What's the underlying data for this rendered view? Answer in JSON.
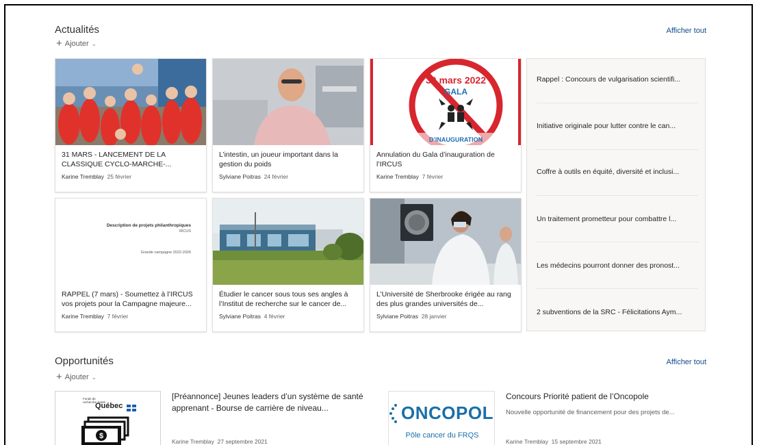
{
  "news": {
    "title": "Actualités",
    "view_all": "Afficher tout",
    "add_label": "Ajouter",
    "cards": [
      {
        "title": "31 MARS - LANCEMENT DE LA CLASSIQUE CYCLO-MARCHE-...",
        "author": "Karine Tremblay",
        "date": "25 février",
        "image": "group-photo-cyclists"
      },
      {
        "title": "L’intestin, un joueur important dans la gestion du poids",
        "author": "Sylviane Poitras",
        "date": "24 février",
        "image": "portrait-lab-photo"
      },
      {
        "title": "Annulation du Gala d’inauguration de l’IRCUS",
        "author": "Karine Tremblay",
        "date": "7 février",
        "image": "cancelled-gala-poster",
        "poster": {
          "date": "30 mars 2022",
          "event": "GALA",
          "caption": "D’INAUGURATION"
        }
      },
      {
        "title": "RAPPEL (7 mars) - Soumettez à l’IRCUS vos projets pour la Campagne majeure...",
        "author": "Karine Tremblay",
        "date": "7 février",
        "image": "document-cover",
        "doc": {
          "heading": "Description de projets philanthropiques",
          "org": "IRCUS",
          "campaign": "Grande campagne 2022-2026"
        }
      },
      {
        "title": "Étudier le cancer sous tous ses angles à l’Institut de recherche sur le cancer de...",
        "author": "Sylviane Poitras",
        "date": "4 février",
        "image": "building-photo"
      },
      {
        "title": "L’Université de Sherbrooke érigée au rang des plus grandes universités de...",
        "author": "Sylviane Poitras",
        "date": "28 janvier",
        "image": "lab-researcher-photo"
      }
    ],
    "list": [
      "Rappel : Concours de vulgarisation scientifi...",
      "Initiative originale pour lutter contre le can...",
      "Coffre à outils en équité, diversité et inclusi...",
      "Un traitement prometteur pour combattre l...",
      "Les médecins pourront donner des pronost...",
      "2 subventions de la SRC - Félicitations Aym..."
    ]
  },
  "opportunities": {
    "title": "Opportunités",
    "view_all": "Afficher tout",
    "add_label": "Ajouter",
    "items": [
      {
        "title": "[Préannonce] Jeunes leaders d’un système de santé apprenant - Bourse de carrière de niveau...",
        "description": "",
        "author": "Karine Tremblay",
        "date": "27 septembre 2021",
        "logo_top": "Fonds de recherche Santé",
        "logo_name": "Québec",
        "logo_symbol": "$"
      },
      {
        "title": "Concours Priorité patient de l’Oncopole",
        "description": "Nouvelle opportunité de financement pour des projets de...",
        "author": "Karine Tremblay",
        "date": "15 septembre 2021",
        "logo_name": "ONCOPOL",
        "logo_sub": "Pôle cancer du FRQS"
      }
    ]
  },
  "colors": {
    "link": "#0f4a8c",
    "gala_red": "#d7262e",
    "gala_blue": "#1f6fb4",
    "oncopole_blue": "#1b6fa8"
  }
}
